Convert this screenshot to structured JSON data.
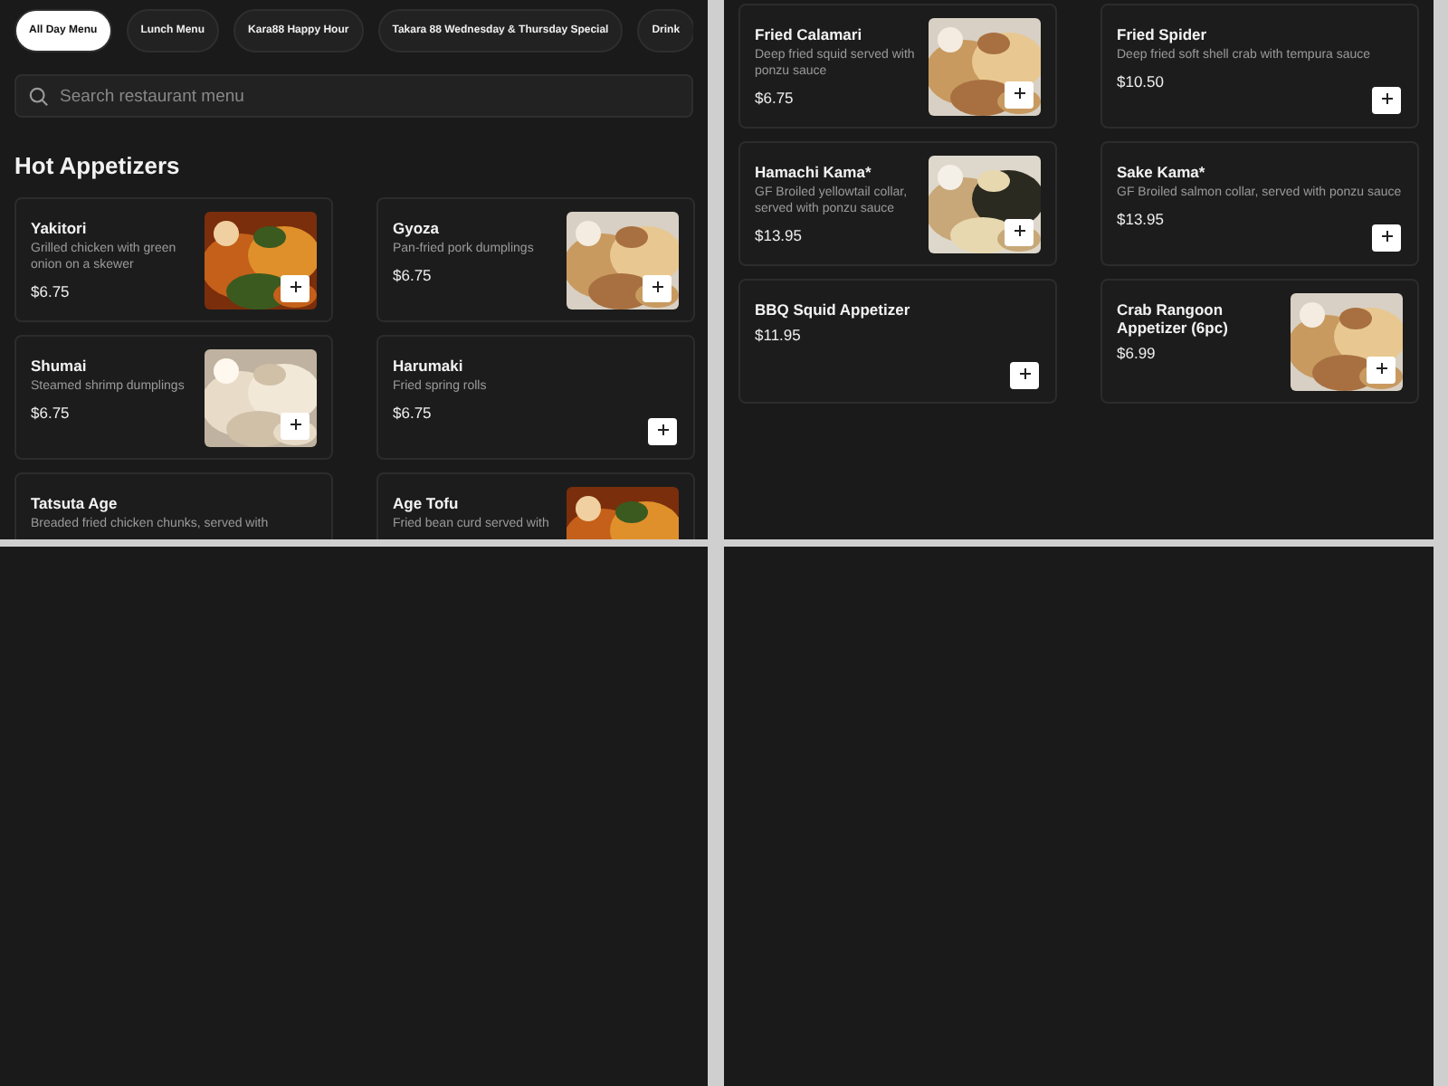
{
  "panels": [
    {
      "tabs": [
        {
          "label": "All Day Menu",
          "selected": true
        },
        {
          "label": "Lunch Menu",
          "selected": false
        },
        {
          "label": "Kara88 Happy Hour",
          "selected": false
        },
        {
          "label": "Takara 88 Wednesday & Thursday Special",
          "selected": false
        },
        {
          "label": "Drink",
          "selected": false
        }
      ],
      "search": {
        "placeholder": "Search restaurant menu"
      },
      "heading": "Hot Appetizers",
      "items": [
        {
          "name": "Yakitori",
          "description": "Grilled chicken with green onion on a skewer",
          "price": "$6.75",
          "photo": true
        },
        {
          "name": "Gyoza",
          "description": "Pan-fried pork dumplings",
          "price": "$6.75",
          "photo": true
        },
        {
          "name": "Shumai",
          "description": "Steamed shrimp dumplings",
          "price": "$6.75",
          "photo": true
        },
        {
          "name": "Harumaki",
          "description": "Fried spring rolls",
          "price": "$6.75",
          "photo": false
        },
        {
          "name": "Tatsuta Age",
          "description": "Breaded fried chicken chunks, served with",
          "photo": false
        },
        {
          "name": "Age Tofu",
          "description": "Fried bean curd served with",
          "photo": true
        }
      ]
    },
    {
      "items": [
        {
          "name": "Fried Calamari",
          "description": "Deep fried squid served with ponzu sauce",
          "price": "$6.75",
          "photo": true
        },
        {
          "name": "Fried Spider",
          "description": "Deep fried soft shell crab with tempura sauce",
          "price": "$10.50",
          "photo": false
        },
        {
          "name": "Hamachi Kama*",
          "description": "GF Broiled yellowtail collar, served with ponzu sauce",
          "price": "$13.95",
          "photo": true
        },
        {
          "name": "Sake Kama*",
          "description": "GF Broiled salmon collar, served with ponzu sauce",
          "price": "$13.95",
          "photo": false
        },
        {
          "name": "BBQ Squid Appetizer",
          "price": "$11.95",
          "photo": false
        },
        {
          "name": "Crab Rangoon Appetizer (6pc)",
          "price": "$6.99",
          "photo": true
        }
      ]
    }
  ]
}
